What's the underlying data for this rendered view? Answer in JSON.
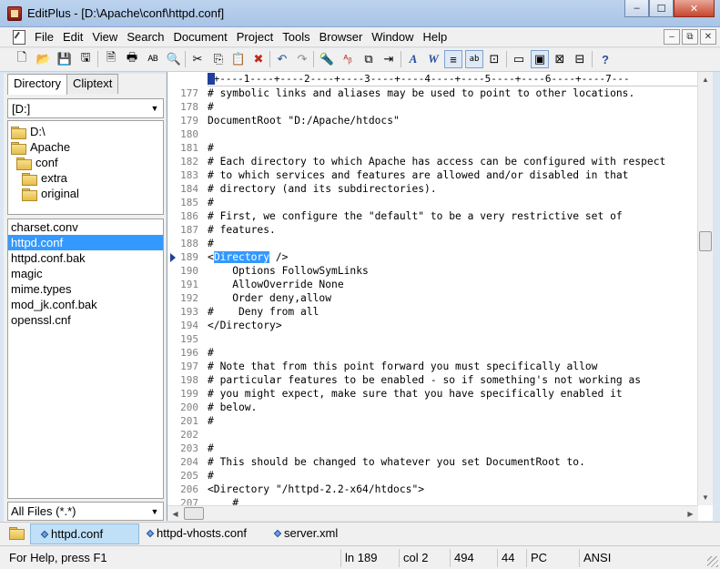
{
  "window": {
    "title": "EditPlus - [D:\\Apache\\conf\\httpd.conf]",
    "minimize": "–",
    "maximize": "☐",
    "close": "✕"
  },
  "menu": [
    "File",
    "Edit",
    "View",
    "Search",
    "Document",
    "Project",
    "Tools",
    "Browser",
    "Window",
    "Help"
  ],
  "mdi_buttons": [
    "–",
    "⧉",
    "✕"
  ],
  "toolbar": [
    {
      "icon": "new-file-icon",
      "glyph": "🗋"
    },
    {
      "icon": "open-folder-icon",
      "glyph": "📂"
    },
    {
      "icon": "save-icon",
      "glyph": "💾"
    },
    {
      "icon": "save-all-icon",
      "glyph": "🖫"
    },
    {
      "icon": "print-preview-icon",
      "glyph": "🗎"
    },
    {
      "icon": "print-icon",
      "glyph": "🖶"
    },
    {
      "icon": "spell-check-icon",
      "glyph": "ᴬᴮ"
    },
    {
      "icon": "find-in-files-icon",
      "glyph": "🔍"
    },
    {
      "icon": "cut-icon",
      "glyph": "✂"
    },
    {
      "icon": "copy-icon",
      "glyph": "⎘"
    },
    {
      "icon": "paste-icon",
      "glyph": "📋"
    },
    {
      "icon": "delete-icon",
      "glyph": "✖"
    },
    {
      "icon": "undo-icon",
      "glyph": "↶"
    },
    {
      "icon": "redo-icon",
      "glyph": "↷"
    },
    {
      "icon": "find-icon",
      "glyph": "🔦"
    },
    {
      "icon": "replace-icon",
      "glyph": "ᴬᵦ"
    },
    {
      "icon": "clipboard-icon",
      "glyph": "⧉"
    },
    {
      "icon": "goto-icon",
      "glyph": "⇥"
    },
    {
      "icon": "font-icon",
      "glyph": "A"
    },
    {
      "icon": "word-wrap-icon",
      "glyph": "W"
    },
    {
      "icon": "line-number-icon",
      "glyph": "≡"
    },
    {
      "icon": "ruler-icon",
      "glyph": "ab"
    },
    {
      "icon": "column-select-icon",
      "glyph": "⊡"
    },
    {
      "icon": "directory-window-icon",
      "glyph": "▭"
    },
    {
      "icon": "output-window-icon",
      "glyph": "▣"
    },
    {
      "icon": "browser-icon",
      "glyph": "⊠"
    },
    {
      "icon": "user-tool-icon",
      "glyph": "⊟"
    },
    {
      "icon": "help-icon",
      "glyph": "?"
    }
  ],
  "left_panel": {
    "tabs": [
      "Directory",
      "Cliptext"
    ],
    "drive": "[D:]",
    "tree": [
      "D:\\",
      "Apache",
      "conf",
      "extra",
      "original"
    ],
    "files": [
      "charset.conv",
      "httpd.conf",
      "httpd.conf.bak",
      "magic",
      "mime.types",
      "mod_jk.conf.bak",
      "openssl.cnf"
    ],
    "selected_file": "httpd.conf",
    "filter": "All Files (*.*)"
  },
  "editor": {
    "ruler": "-+----1----+----2----+----3----+----4----+----5----+----6----+----7---",
    "current_line": "189",
    "lines": [
      {
        "n": "177",
        "text": "# symbolic links and aliases may be used to point to other locations."
      },
      {
        "n": "178",
        "text": "#"
      },
      {
        "n": "179",
        "text": "DocumentRoot \"D:/Apache/htdocs\""
      },
      {
        "n": "180",
        "text": ""
      },
      {
        "n": "181",
        "text": "#"
      },
      {
        "n": "182",
        "text": "# Each directory to which Apache has access can be configured with respect"
      },
      {
        "n": "183",
        "text": "# to which services and features are allowed and/or disabled in that"
      },
      {
        "n": "184",
        "text": "# directory (and its subdirectories)."
      },
      {
        "n": "185",
        "text": "#"
      },
      {
        "n": "186",
        "text": "# First, we configure the \"default\" to be a very restrictive set of"
      },
      {
        "n": "187",
        "text": "# features."
      },
      {
        "n": "188",
        "text": "#"
      },
      {
        "n": "189",
        "text": "<Directory />",
        "pre": "<",
        "sel": "Directory",
        "post": " />"
      },
      {
        "n": "190",
        "text": "    Options FollowSymLinks"
      },
      {
        "n": "191",
        "text": "    AllowOverride None"
      },
      {
        "n": "192",
        "text": "    Order deny,allow"
      },
      {
        "n": "193",
        "text": "#    Deny from all"
      },
      {
        "n": "194",
        "text": "</Directory>"
      },
      {
        "n": "195",
        "text": ""
      },
      {
        "n": "196",
        "text": "#"
      },
      {
        "n": "197",
        "text": "# Note that from this point forward you must specifically allow"
      },
      {
        "n": "198",
        "text": "# particular features to be enabled - so if something's not working as"
      },
      {
        "n": "199",
        "text": "# you might expect, make sure that you have specifically enabled it"
      },
      {
        "n": "200",
        "text": "# below."
      },
      {
        "n": "201",
        "text": "#"
      },
      {
        "n": "202",
        "text": ""
      },
      {
        "n": "203",
        "text": "#"
      },
      {
        "n": "204",
        "text": "# This should be changed to whatever you set DocumentRoot to."
      },
      {
        "n": "205",
        "text": "#"
      },
      {
        "n": "206",
        "text": "<Directory \"/httpd-2.2-x64/htdocs\">"
      },
      {
        "n": "207",
        "text": "    #"
      }
    ]
  },
  "doc_tabs": [
    "httpd.conf",
    "httpd-vhosts.conf",
    "server.xml"
  ],
  "active_doc": "httpd.conf",
  "status": {
    "help": "For Help, press F1",
    "line": "ln 189",
    "col": "col 2",
    "total_lines": "494",
    "offset": "44",
    "format": "PC",
    "encoding": "ANSI"
  },
  "colors": {
    "selection": "#3399ff",
    "title_bar": "#bcd3ee",
    "active_doc_tab": "#bfe0f7"
  }
}
